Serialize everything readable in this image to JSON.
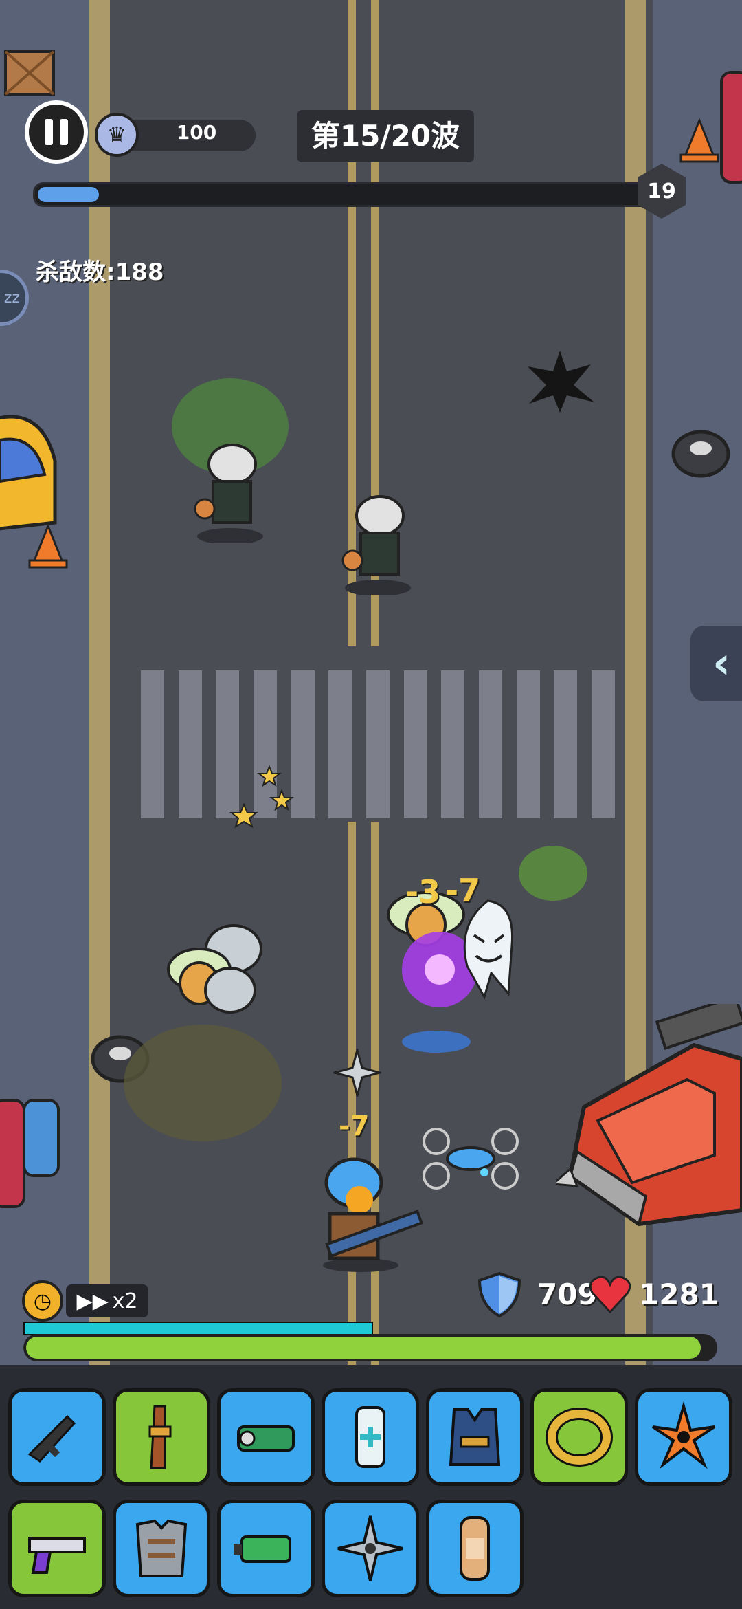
{
  "hud": {
    "crown_value": "100",
    "wave_title": "第15/20波",
    "wave_progress": 0.1,
    "level": "19",
    "kill_label": "杀敌数:188",
    "zz_label": "zz"
  },
  "status": {
    "speed_label": "x2",
    "shield_value": "709",
    "hp_value": "1281",
    "hp_fraction": 0.98,
    "energy_fraction": 0.5
  },
  "combat_text": {
    "damage_a": "-3",
    "damage_b": "-7",
    "damage_c": "-7"
  },
  "skill_slots": [
    {
      "name": "rifle-icon",
      "highlight": false
    },
    {
      "name": "sniper-icon",
      "highlight": true
    },
    {
      "name": "flashlight-icon",
      "highlight": false
    },
    {
      "name": "medkit-icon",
      "highlight": false
    },
    {
      "name": "armor-vest-icon",
      "highlight": false
    },
    {
      "name": "ring-icon",
      "highlight": true
    },
    {
      "name": "shuriken-icon",
      "highlight": false
    },
    {
      "name": "pistol-icon",
      "highlight": true
    },
    {
      "name": "chest-plate-icon",
      "highlight": false
    },
    {
      "name": "battery-icon",
      "highlight": false
    },
    {
      "name": "throwing-star-icon",
      "highlight": false
    },
    {
      "name": "bandage-icon",
      "highlight": false
    }
  ],
  "colors": {
    "hp_bar": "#8fd23b",
    "progress": "#5fa0ea",
    "slot_blue": "#3aa7ee",
    "slot_green": "#86c63b"
  }
}
